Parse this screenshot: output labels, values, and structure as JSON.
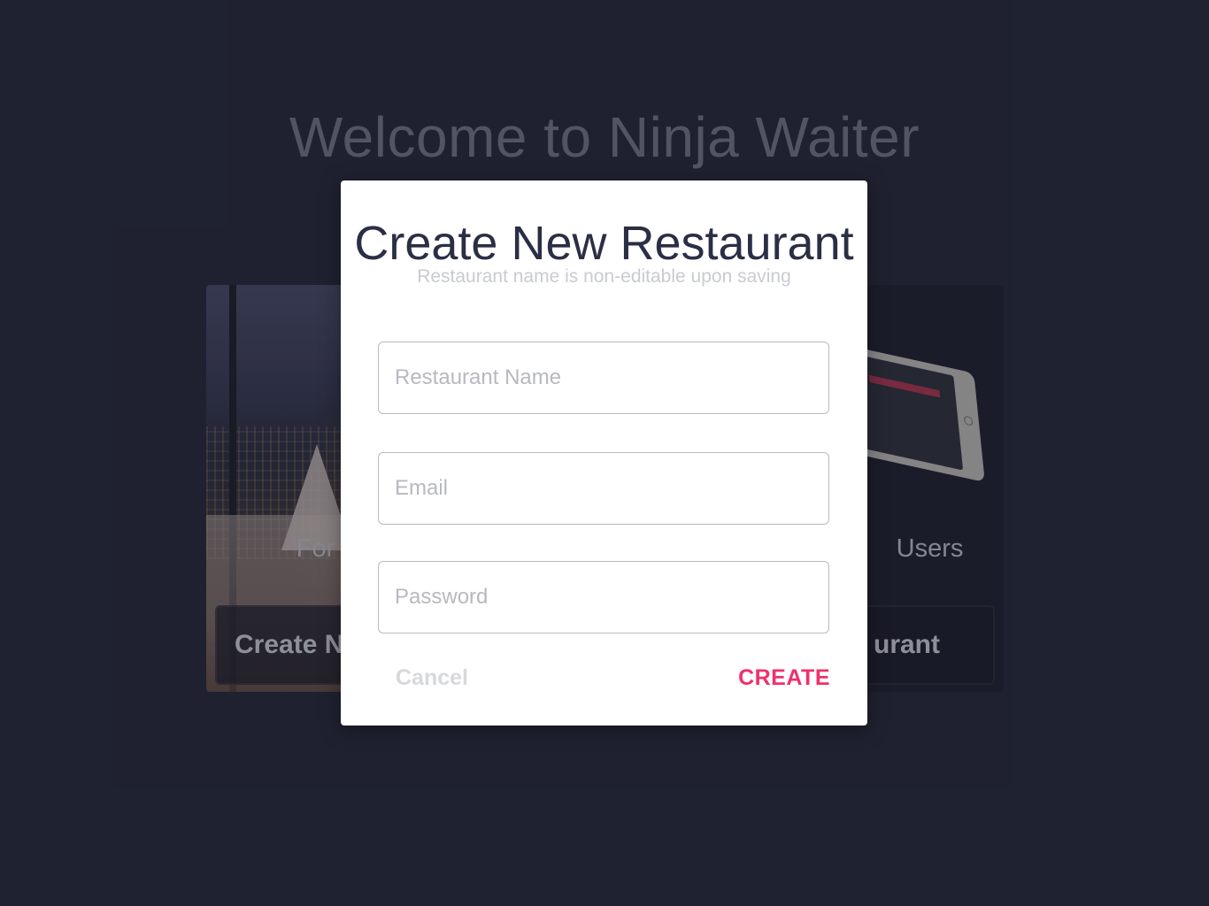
{
  "welcome_title": "Welcome to Ninja Waiter",
  "cards": {
    "left": {
      "label": "For",
      "button_label": "Create N"
    },
    "right": {
      "label": "Users",
      "button_label": "urant"
    }
  },
  "modal": {
    "title": "Create New Restaurant",
    "subtitle": "Restaurant name is non-editable upon saving",
    "fields": {
      "restaurant_name": {
        "placeholder": "Restaurant Name",
        "value": ""
      },
      "email": {
        "placeholder": "Email",
        "value": ""
      },
      "password": {
        "placeholder": "Password",
        "value": ""
      }
    },
    "cancel_label": "Cancel",
    "create_label": "CREATE"
  },
  "colors": {
    "background": "#1f2230",
    "accent": "#f0306a",
    "title_text": "#2b2f45"
  }
}
